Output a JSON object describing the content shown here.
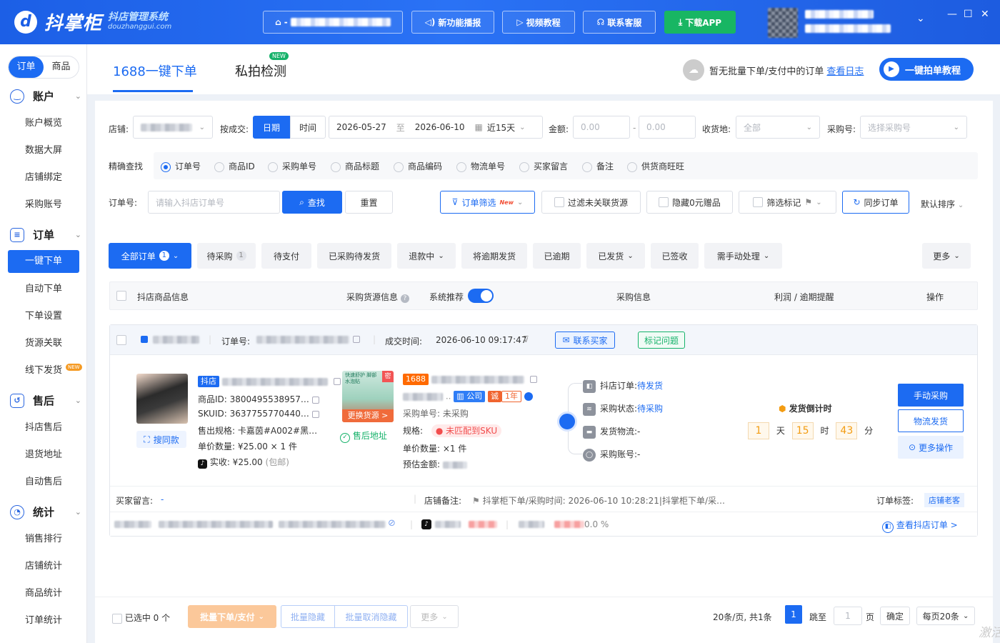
{
  "header": {
    "logo_mark": "d",
    "logo_name": "抖掌柜",
    "logo_sub": "抖店管理系统",
    "logo_domain": "douzhanggui.com",
    "shop_prefix": "-",
    "buttons": [
      "新功能播报",
      "视频教程",
      "联系客服",
      "下载APP"
    ],
    "window_controls": [
      "—",
      "☐",
      "✕"
    ],
    "chevron": "⌄"
  },
  "sidebar": {
    "seg": [
      "订单",
      "商品"
    ],
    "groups": [
      {
        "title": "账户",
        "icon": "smile-icon",
        "items": [
          "账户概览",
          "数据大屏",
          "店铺绑定",
          "采购账号"
        ]
      },
      {
        "title": "订单",
        "icon": "list-icon",
        "items": [
          "一键下单",
          "自动下单",
          "下单设置",
          "货源关联",
          "线下发货"
        ]
      },
      {
        "title": "售后",
        "icon": "refund-icon",
        "items": [
          "抖店售后",
          "退货地址",
          "自动售后"
        ]
      },
      {
        "title": "统计",
        "icon": "pie-icon",
        "items": [
          "销售排行",
          "店铺统计",
          "商品统计",
          "订单统计"
        ]
      }
    ],
    "new_tag": "NEW"
  },
  "tabs": {
    "items": [
      "1688一键下单",
      "私拍检测"
    ],
    "new_badge": "NEW",
    "tip": "暂无批量下单/支付中的订单",
    "tip_link": "查看日志",
    "tutorial": "一键拍单教程"
  },
  "filters": {
    "shop_label": "店铺:",
    "deal_label": "按成交:",
    "deal_opts": [
      "日期",
      "时间"
    ],
    "date_start": "2026-05-27",
    "date_to": "至",
    "date_end": "2026-06-10",
    "date_range": "近15天",
    "amount_label": "金额:",
    "amount_min": "0.00",
    "amount_dash": "-",
    "amount_max": "0.00",
    "recv_label": "收货地:",
    "recv_value": "全部",
    "purchase_label": "采购号:",
    "purchase_ph": "选择采购号",
    "exact_label": "精确查找",
    "radios": [
      "订单号",
      "商品ID",
      "采购单号",
      "商品标题",
      "商品编码",
      "物流单号",
      "买家留言",
      "备注",
      "供货商旺旺"
    ],
    "order_label": "订单号:",
    "order_ph": "请输入抖店订单号",
    "search_btn": "查找",
    "reset_btn": "重置",
    "order_filter": "订单筛选",
    "order_filter_new": "New",
    "filter_unrelated": "过滤未关联货源",
    "hide_zero": "隐藏0元赠品",
    "filter_flag": "筛选标记",
    "sync": "同步订单",
    "sort": "默认排序"
  },
  "status_tabs": [
    {
      "label": "全部订单",
      "count": "1"
    },
    {
      "label": "待采购",
      "count": "1"
    },
    {
      "label": "待支付"
    },
    {
      "label": "已采购待发货"
    },
    {
      "label": "退款中"
    },
    {
      "label": "将逾期发货"
    },
    {
      "label": "已逾期"
    },
    {
      "label": "已发货"
    },
    {
      "label": "已签收"
    },
    {
      "label": "需手动处理"
    },
    {
      "label": "更多"
    }
  ],
  "table_head": {
    "col1": "抖店商品信息",
    "col2": "采购货源信息",
    "col3": "系统推荐",
    "col4": "采购信息",
    "col5": "利润 / 逾期提醒",
    "col6": "操作"
  },
  "order": {
    "order_no_label": "订单号:",
    "deal_time_label": "成交时间:",
    "deal_time": "2026-06-10 09:17:47",
    "contact_btn": "联系买家",
    "mark_btn": "标记问题",
    "shop_tag": "抖店",
    "product_id": "商品ID: 3800495538957…",
    "skuid": "SKUID: 3637755770440…",
    "spec": "售出规格: 卡嘉茵#A002#黑…",
    "unit_qty": "单价数量: ¥25.00 × 1 件",
    "paid": "实收: ¥25.00",
    "paid_note": "(包邮)",
    "same_btn": "搜同款",
    "src_img_text": "快速舒护 脚部水泡贴",
    "src_mi": "密",
    "src_switch": "更换货源 >",
    "after_sale": "售后地址",
    "src_tag": "1688",
    "company_tag": "公司",
    "cheng_tag": "诚",
    "year_tag": "1年",
    "purchase_no": "采购单号: 未采购",
    "spec_label": "规格:",
    "sku_warn": "未匹配到SKU",
    "unit_qty2": "单价数量:  ×1 件",
    "est_amount": "预估金额:",
    "flow": [
      {
        "label": "抖店订单:",
        "value": "待发货"
      },
      {
        "label": "采购状态:",
        "value": "待采购"
      },
      {
        "label": "发货物流:",
        "value": "-"
      },
      {
        "label": "采购账号:",
        "value": "-"
      }
    ],
    "countdown_title": "发货倒计时",
    "countdown": {
      "d": "1",
      "d_u": "天",
      "h": "15",
      "h_u": "时",
      "m": "43",
      "m_u": "分"
    },
    "actions": [
      "手动采购",
      "物流发货",
      "更多操作"
    ],
    "buyer_msg_label": "买家留言:",
    "buyer_msg": "-",
    "shop_note_label": "店铺备注:",
    "shop_note": "抖掌柜下单/采购时间: 2026-06-10 10:28:21|抖掌柜下单/采…",
    "order_tag_label": "订单标签:",
    "order_tag": "店铺老客",
    "rate": "0.0 %",
    "view_order": "查看抖店订单 >"
  },
  "footer": {
    "selected": "已选中 0 个",
    "batch_pay": "批量下单/支付",
    "batch_hide": "批量隐藏",
    "batch_unhide": "批量取消隐藏",
    "more": "更多",
    "per_page_info": "20条/页, 共1条",
    "page": "1",
    "jump": "跳至",
    "jump_val": "1",
    "page_unit": "页",
    "confirm": "确定",
    "per_page": "每页20条",
    "watermark": "激活"
  }
}
